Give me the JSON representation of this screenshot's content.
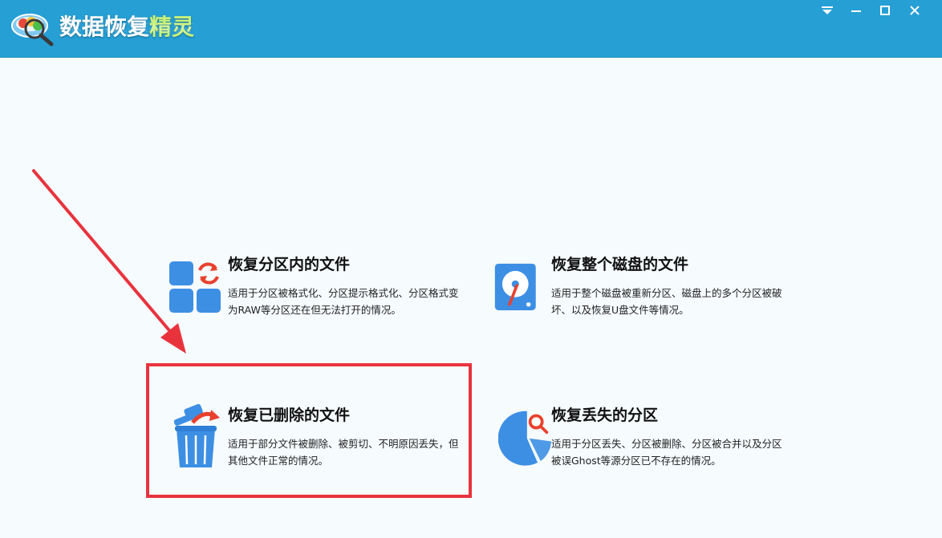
{
  "app": {
    "title_main": "数据恢复",
    "title_accent": "精灵"
  },
  "window_controls": {
    "menu_icon": "dropdown-menu-icon",
    "minimize_icon": "minimize-icon",
    "maximize_icon": "maximize-icon",
    "close_icon": "close-icon"
  },
  "options": [
    {
      "title": "恢复分区内的文件",
      "desc": "适用于分区被格式化、分区提示格式化、分区格式变为RAW等分区还在但无法打开的情况。",
      "icon": "partition-files-icon"
    },
    {
      "title": "恢复整个磁盘的文件",
      "desc": "适用于整个磁盘被重新分区、磁盘上的多个分区被破坏、以及恢复U盘文件等情况。",
      "icon": "disk-icon"
    },
    {
      "title": "恢复已删除的文件",
      "desc": "适用于部分文件被删除、被剪切、不明原因丢失，但其他文件正常的情况。",
      "icon": "recycle-bin-icon"
    },
    {
      "title": "恢复丢失的分区",
      "desc": "适用于分区丢失、分区被删除、分区被合并以及分区被误Ghost等源分区已不存在的情况。",
      "icon": "lost-partition-icon"
    }
  ],
  "colors": {
    "titlebar": "#269fd5",
    "accent_blue": "#3d8fe4",
    "highlight_red": "#e8333d",
    "background": "#f6fbfe"
  }
}
